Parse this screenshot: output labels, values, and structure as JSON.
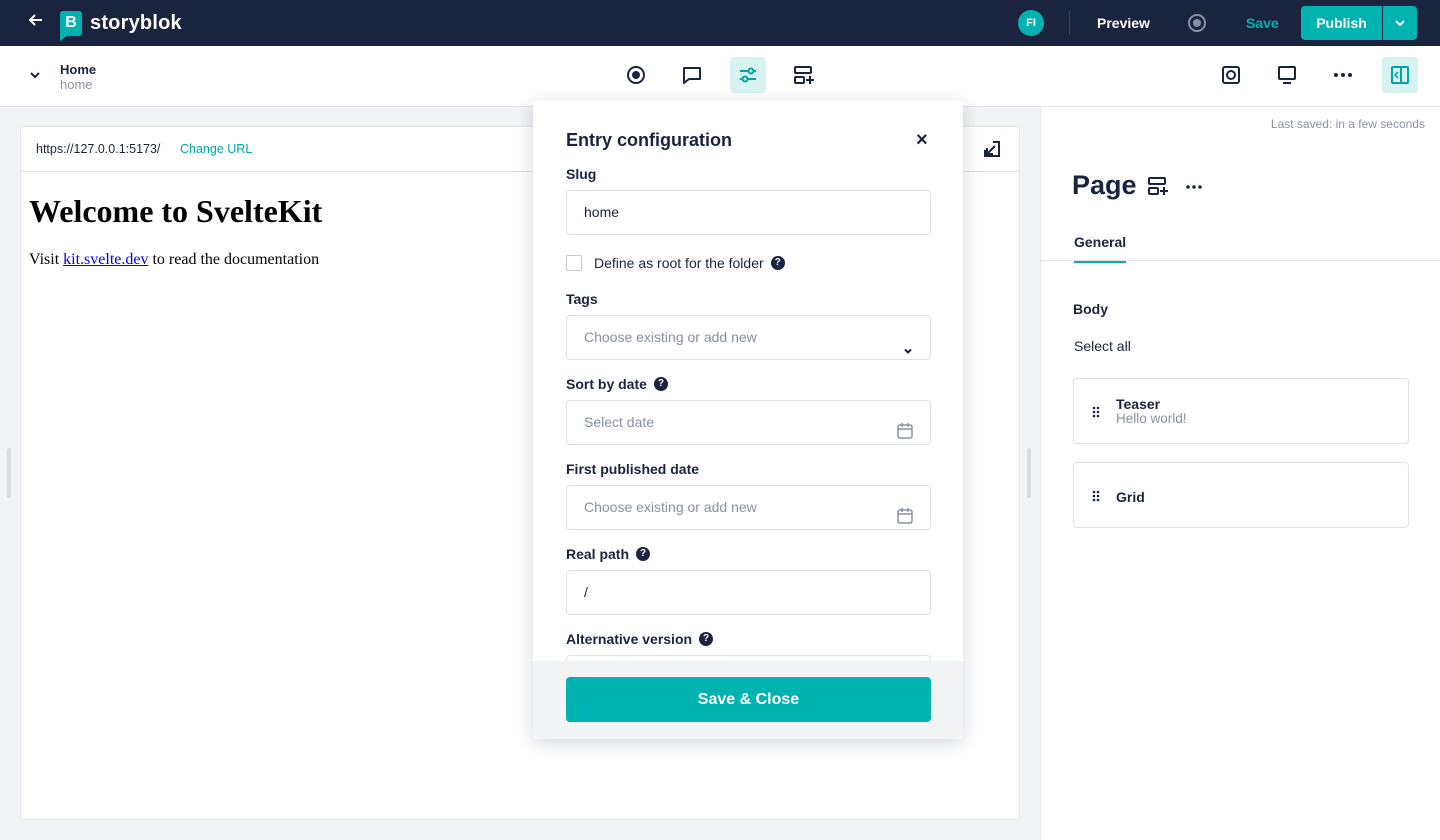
{
  "topbar": {
    "brand": "storyblok",
    "logo_letter": "B",
    "avatar_initials": "FI",
    "preview_label": "Preview",
    "save_label": "Save",
    "publish_label": "Publish",
    "accent_color": "#00b3b0",
    "bg_color": "#1b243f"
  },
  "toolbar": {
    "story_name": "Home",
    "story_slug": "home",
    "icons": [
      "status-icon",
      "comments-icon",
      "entry-config-icon",
      "add-block-icon",
      "screen-icon",
      "desktop-icon",
      "more-icon",
      "panel-toggle-icon"
    ]
  },
  "preview": {
    "url": "https://127.0.0.1:5173/",
    "change_url_label": "Change URL",
    "heading": "Welcome to SvelteKit",
    "para_before": "Visit ",
    "link_text": "kit.svelte.dev",
    "para_after": " to read the documentation"
  },
  "panel": {
    "last_saved": "Last saved: in a few seconds",
    "title": "Page",
    "tab_general": "General",
    "body_label": "Body",
    "select_all": "Select all",
    "blocks": [
      {
        "name": "Teaser",
        "subtitle": "Hello world!"
      },
      {
        "name": "Grid",
        "subtitle": ""
      }
    ]
  },
  "modal": {
    "title": "Entry configuration",
    "slug_label": "Slug",
    "slug_value": "home",
    "root_label": "Define as root for the folder",
    "root_checked": false,
    "tags_label": "Tags",
    "tags_placeholder": "Choose existing or add new",
    "sort_date_label": "Sort by date",
    "sort_date_placeholder": "Select date",
    "first_published_label": "First published date",
    "first_published_placeholder": "Choose existing or add new",
    "real_path_label": "Real path",
    "real_path_value": "/",
    "alt_version_label": "Alternative version",
    "save_close_label": "Save & Close",
    "help_glyph": "?"
  }
}
